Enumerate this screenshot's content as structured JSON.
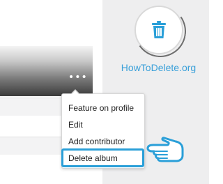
{
  "menu": {
    "items": [
      "Feature on profile",
      "Edit",
      "Add contributor",
      "Delete album"
    ],
    "selected": "Delete album"
  },
  "album": {
    "more_label": "•••"
  },
  "brand": {
    "name": "HowToDelete.org",
    "color": "#3aa0d9",
    "icon": "trash-icon"
  },
  "colors": {
    "highlight": "#2a9fd8",
    "side_panel": "#eeeeef"
  },
  "pointer": {
    "icon": "hand-pointer-icon"
  }
}
